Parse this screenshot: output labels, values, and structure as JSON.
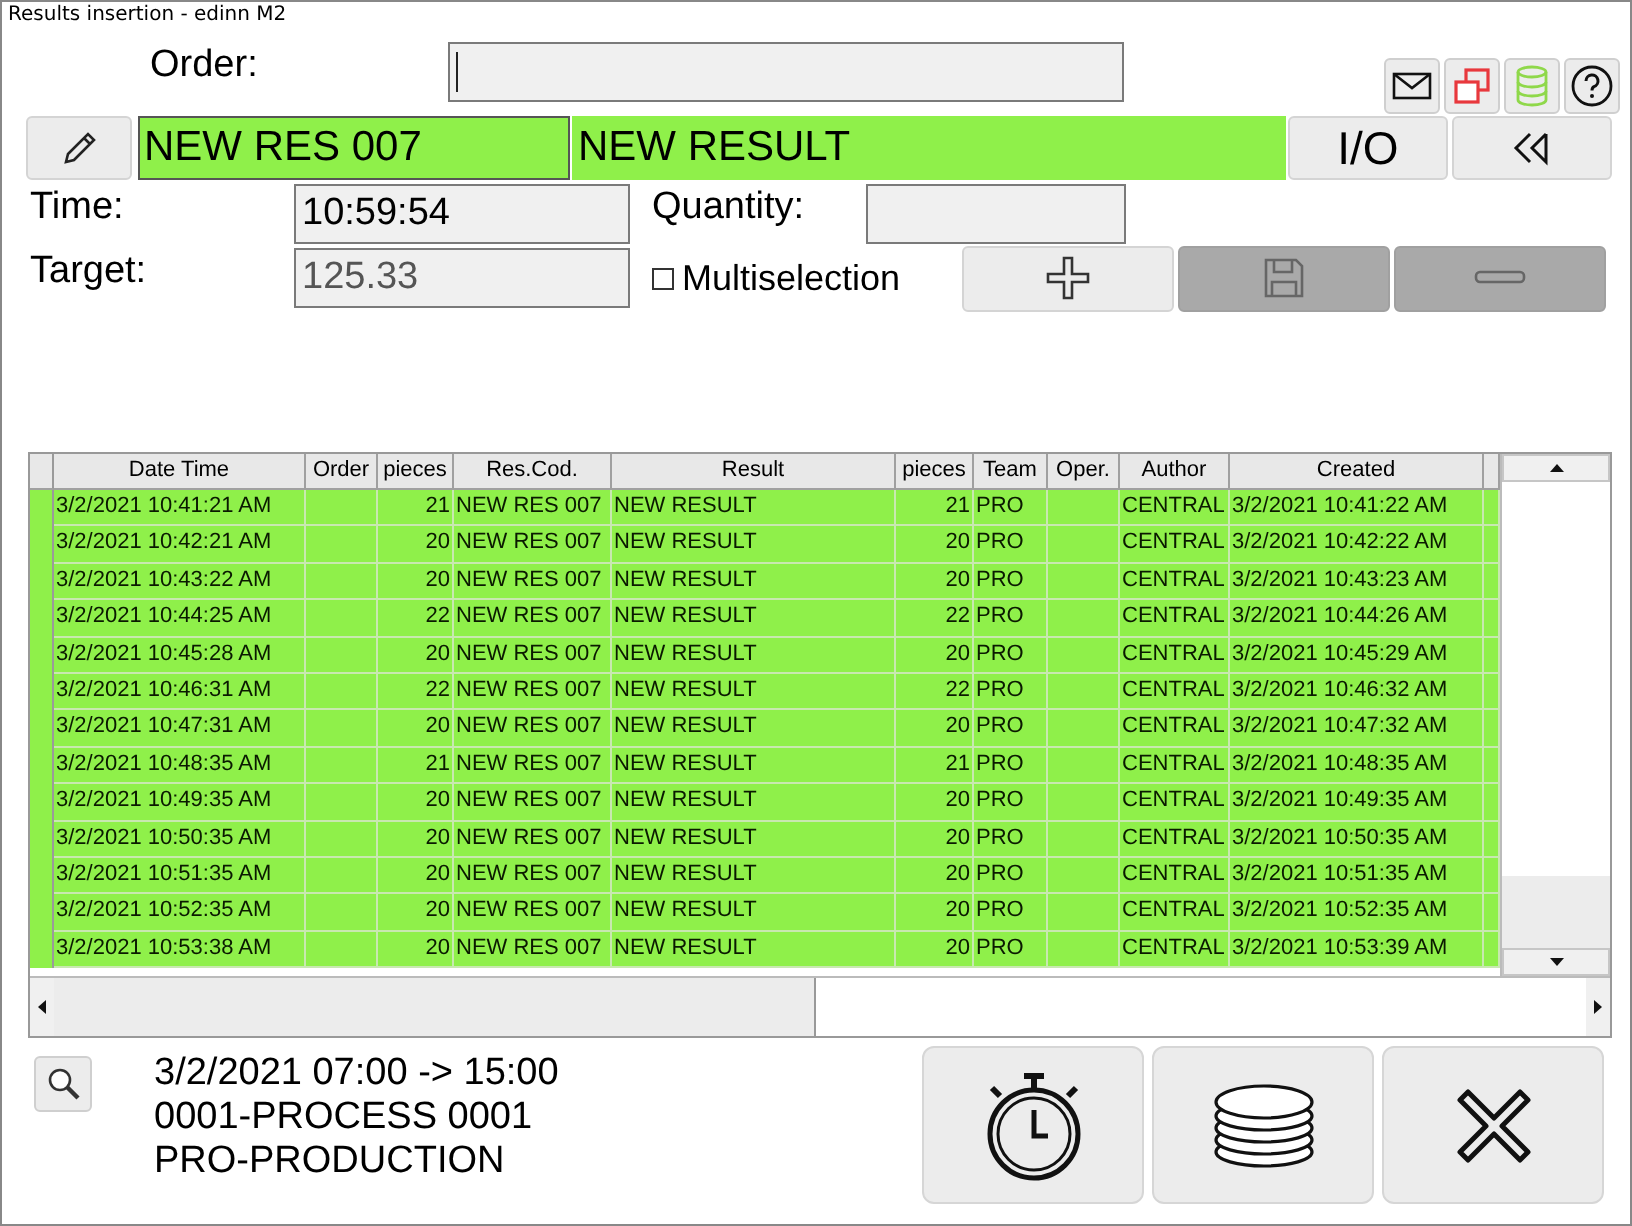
{
  "window": {
    "title": "Results insertion - edinn M2"
  },
  "order": {
    "label": "Order:"
  },
  "top_icons": [
    {
      "kind": "mail",
      "disabled": false
    },
    {
      "kind": "windows",
      "disabled": false
    },
    {
      "kind": "database",
      "disabled": false
    },
    {
      "kind": "help",
      "disabled": false
    }
  ],
  "result_row": {
    "code": "NEW RES 007",
    "name": "NEW RESULT",
    "io_button": "I/O"
  },
  "time": {
    "label": "Time:",
    "value": "10:59:54"
  },
  "quantity": {
    "label": "Quantity:"
  },
  "target": {
    "label": "Target:",
    "value": "125.33"
  },
  "multiselection": {
    "label": "Multiselection",
    "checked": false
  },
  "actions": [
    {
      "kind": "add",
      "disabled": false
    },
    {
      "kind": "save",
      "disabled": true
    },
    {
      "kind": "remove",
      "disabled": true
    }
  ],
  "table": {
    "columns": [
      "Date Time",
      "Order",
      "pieces",
      "Res.Cod.",
      "Result",
      "pieces",
      "Team",
      "Oper.",
      "Author",
      "Created"
    ],
    "rows": [
      [
        "3/2/2021 10:41:21 AM",
        "",
        "21",
        "NEW RES 007",
        "NEW RESULT",
        "21",
        "PRO",
        "",
        "CENTRAL",
        "3/2/2021 10:41:22 AM"
      ],
      [
        "3/2/2021 10:42:21 AM",
        "",
        "20",
        "NEW RES 007",
        "NEW RESULT",
        "20",
        "PRO",
        "",
        "CENTRAL",
        "3/2/2021 10:42:22 AM"
      ],
      [
        "3/2/2021 10:43:22 AM",
        "",
        "20",
        "NEW RES 007",
        "NEW RESULT",
        "20",
        "PRO",
        "",
        "CENTRAL",
        "3/2/2021 10:43:23 AM"
      ],
      [
        "3/2/2021 10:44:25 AM",
        "",
        "22",
        "NEW RES 007",
        "NEW RESULT",
        "22",
        "PRO",
        "",
        "CENTRAL",
        "3/2/2021 10:44:26 AM"
      ],
      [
        "3/2/2021 10:45:28 AM",
        "",
        "20",
        "NEW RES 007",
        "NEW RESULT",
        "20",
        "PRO",
        "",
        "CENTRAL",
        "3/2/2021 10:45:29 AM"
      ],
      [
        "3/2/2021 10:46:31 AM",
        "",
        "22",
        "NEW RES 007",
        "NEW RESULT",
        "22",
        "PRO",
        "",
        "CENTRAL",
        "3/2/2021 10:46:32 AM"
      ],
      [
        "3/2/2021 10:47:31 AM",
        "",
        "20",
        "NEW RES 007",
        "NEW RESULT",
        "20",
        "PRO",
        "",
        "CENTRAL",
        "3/2/2021 10:47:32 AM"
      ],
      [
        "3/2/2021 10:48:35 AM",
        "",
        "21",
        "NEW RES 007",
        "NEW RESULT",
        "21",
        "PRO",
        "",
        "CENTRAL",
        "3/2/2021 10:48:35 AM"
      ],
      [
        "3/2/2021 10:49:35 AM",
        "",
        "20",
        "NEW RES 007",
        "NEW RESULT",
        "20",
        "PRO",
        "",
        "CENTRAL",
        "3/2/2021 10:49:35 AM"
      ],
      [
        "3/2/2021 10:50:35 AM",
        "",
        "20",
        "NEW RES 007",
        "NEW RESULT",
        "20",
        "PRO",
        "",
        "CENTRAL",
        "3/2/2021 10:50:35 AM"
      ],
      [
        "3/2/2021 10:51:35 AM",
        "",
        "20",
        "NEW RES 007",
        "NEW RESULT",
        "20",
        "PRO",
        "",
        "CENTRAL",
        "3/2/2021 10:51:35 AM"
      ],
      [
        "3/2/2021 10:52:35 AM",
        "",
        "20",
        "NEW RES 007",
        "NEW RESULT",
        "20",
        "PRO",
        "",
        "CENTRAL",
        "3/2/2021 10:52:35 AM"
      ],
      [
        "3/2/2021 10:53:38 AM",
        "",
        "20",
        "NEW RES 007",
        "NEW RESULT",
        "20",
        "PRO",
        "",
        "CENTRAL",
        "3/2/2021 10:53:39 AM"
      ]
    ]
  },
  "shift": {
    "lines": [
      "3/2/2021 07:00 -> 15:00",
      "0001-PROCESS 0001",
      "PRO-PRODUCTION"
    ]
  },
  "bottom_buttons": [
    {
      "kind": "stopwatch"
    },
    {
      "kind": "coins"
    },
    {
      "kind": "close"
    }
  ]
}
